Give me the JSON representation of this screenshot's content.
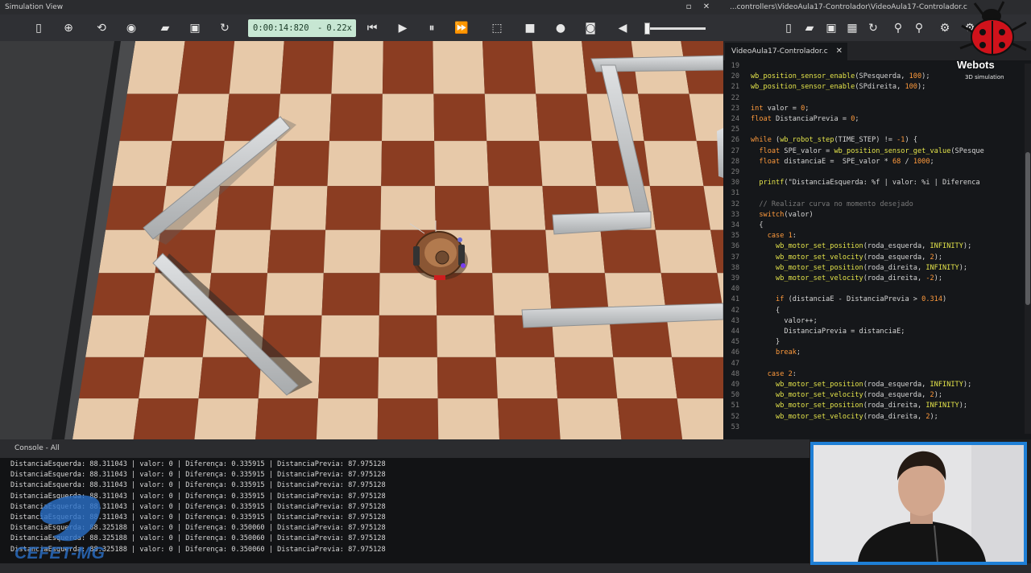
{
  "sim_window": {
    "title": "Simulation View",
    "time": "0:00:14:820",
    "separator": "-",
    "speed": "0.22x"
  },
  "editor_window": {
    "title": "...controllers\\VideoAula17-Controlador\\VideoAula17-Controlador.c",
    "tab_label": "VideoAula17-Controlador.c",
    "lines": [
      {
        "n": "19",
        "text": ""
      },
      {
        "n": "20",
        "text": "wb_position_sensor_enable(SPesquerda, 100);"
      },
      {
        "n": "21",
        "text": "wb_position_sensor_enable(SPdireita, 100);"
      },
      {
        "n": "22",
        "text": ""
      },
      {
        "n": "23",
        "text": "int valor = 0;"
      },
      {
        "n": "24",
        "text": "float DistanciaPrevia = 0;"
      },
      {
        "n": "25",
        "text": ""
      },
      {
        "n": "26",
        "text": "while (wb_robot_step(TIME_STEP) != -1) {"
      },
      {
        "n": "27",
        "text": "  float SPE_valor = wb_position_sensor_get_value(SPesque"
      },
      {
        "n": "28",
        "text": "  float distanciaE =  SPE_valor * 68 / 1000;"
      },
      {
        "n": "29",
        "text": ""
      },
      {
        "n": "30",
        "text": "  printf(\"DistanciaEsquerda: %f | valor: %i | Diferenca"
      },
      {
        "n": "31",
        "text": ""
      },
      {
        "n": "32",
        "text": "  // Realizar curva no momento desejado"
      },
      {
        "n": "33",
        "text": "  switch(valor)"
      },
      {
        "n": "34",
        "text": "  {"
      },
      {
        "n": "35",
        "text": "    case 1:"
      },
      {
        "n": "36",
        "text": "      wb_motor_set_position(roda_esquerda, INFINITY);"
      },
      {
        "n": "37",
        "text": "      wb_motor_set_velocity(roda_esquerda, 2);"
      },
      {
        "n": "38",
        "text": "      wb_motor_set_position(roda_direita, INFINITY);"
      },
      {
        "n": "39",
        "text": "      wb_motor_set_velocity(roda_direita, -2);"
      },
      {
        "n": "40",
        "text": ""
      },
      {
        "n": "41",
        "text": "      if (distanciaE - DistanciaPrevia > 0.314)"
      },
      {
        "n": "42",
        "text": "      {"
      },
      {
        "n": "43",
        "text": "        valor++;"
      },
      {
        "n": "44",
        "text": "        DistanciaPrevia = distanciaE;"
      },
      {
        "n": "45",
        "text": "      }"
      },
      {
        "n": "46",
        "text": "      break;"
      },
      {
        "n": "47",
        "text": ""
      },
      {
        "n": "48",
        "text": "    case 2:"
      },
      {
        "n": "49",
        "text": "      wb_motor_set_position(roda_esquerda, INFINITY);"
      },
      {
        "n": "50",
        "text": "      wb_motor_set_velocity(roda_esquerda, 2);"
      },
      {
        "n": "51",
        "text": "      wb_motor_set_position(roda_direita, INFINITY);"
      },
      {
        "n": "52",
        "text": "      wb_motor_set_velocity(roda_direita, 2);"
      },
      {
        "n": "53",
        "text": ""
      }
    ]
  },
  "console": {
    "title": "Console - All",
    "lines": [
      "DistanciaEsquerda: 88.311043 | valor: 0 | Diferença: 0.335915 | DistanciaPrevia: 87.975128",
      "DistanciaEsquerda: 88.311043 | valor: 0 | Diferença: 0.335915 | DistanciaPrevia: 87.975128",
      "DistanciaEsquerda: 88.311043 | valor: 0 | Diferença: 0.335915 | DistanciaPrevia: 87.975128",
      "DistanciaEsquerda: 88.311043 | valor: 0 | Diferença: 0.335915 | DistanciaPrevia: 87.975128",
      "DistanciaEsquerda: 88.311043 | valor: 0 | Diferença: 0.335915 | DistanciaPrevia: 87.975128",
      "DistanciaEsquerda: 88.311043 | valor: 0 | Diferença: 0.335915 | DistanciaPrevia: 87.975128",
      "DistanciaEsquerda: 88.325188 | valor: 0 | Diferença: 0.350060 | DistanciaPrevia: 87.975128",
      "DistanciaEsquerda: 88.325188 | valor: 0 | Diferença: 0.350060 | DistanciaPrevia: 87.975128",
      "DistanciaEsquerda: 88.325188 | valor: 0 | Diferença: 0.350060 | DistanciaPrevia: 87.975128"
    ]
  },
  "logo": {
    "brand": "Webots",
    "sub": "3D simulation"
  },
  "watermark": {
    "text": "CEFET-MG"
  },
  "icons": {
    "sim_toolbar": [
      "panel-toggle-icon",
      "add-node-icon",
      "reload-node-icon",
      "eye-icon",
      "open-world-icon",
      "save-world-icon",
      "reload-world-icon",
      "step-back-icon",
      "step-icon",
      "pause-icon",
      "fast-forward-icon",
      "view-3d-icon",
      "stop-icon",
      "record-icon",
      "camera-icon",
      "volume-icon"
    ],
    "editor_toolbar": [
      "new-file-icon",
      "open-file-icon",
      "save-file-icon",
      "save-all-icon",
      "revert-icon",
      "search-icon",
      "replace-icon",
      "settings-icon",
      "build-icon"
    ]
  },
  "colors": {
    "light_square": "#e7c9a9",
    "dark_square": "#8b3d22",
    "wall": "#c9ccce",
    "time_box": "#c7e7d3",
    "webcam_border": "#1e7fd6",
    "code_keyword": "#ff9a3c",
    "code_function": "#e3e34a",
    "code_number": "#ff9a3c",
    "code_comment": "#7a7a7a",
    "code_string": "#d6d6d6"
  }
}
